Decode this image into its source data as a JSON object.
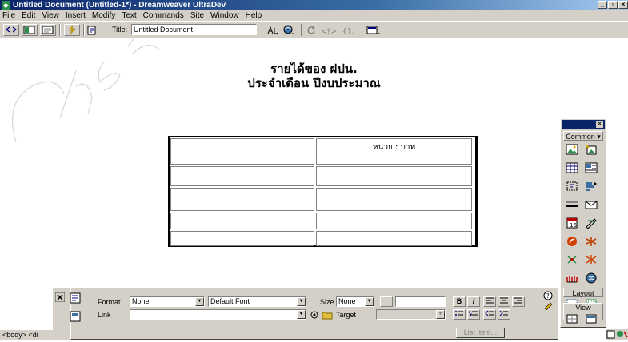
{
  "window": {
    "title": "Untitled Document (Untitled-1*) - Dreamweaver UltraDev"
  },
  "menu": [
    "File",
    "Edit",
    "View",
    "Insert",
    "Modify",
    "Text",
    "Commands",
    "Site",
    "Window",
    "Help"
  ],
  "toolbar": {
    "title_label": "Title:",
    "title_value": "Untitled Document"
  },
  "document": {
    "heading_line1": "รายได้ของ ฝปน.",
    "heading_line2": "ประจำเดือน ปีงบประมาณ",
    "table": {
      "rows": [
        [
          "",
          "หน่วย : บาท"
        ],
        [
          "",
          ""
        ],
        [
          "",
          ""
        ],
        [
          "",
          ""
        ],
        [
          "",
          ""
        ]
      ]
    }
  },
  "objects_panel": {
    "category_common": "Common",
    "category_layout": "Layout",
    "category_view": "View"
  },
  "properties": {
    "format_label": "Format",
    "format_value": "None",
    "font_value": "Default Font",
    "size_label": "Size",
    "size_value": "None",
    "link_label": "Link",
    "target_label": "Target",
    "list_item_button": "List Item..."
  },
  "status": {
    "tag_path": "<body> <di"
  }
}
